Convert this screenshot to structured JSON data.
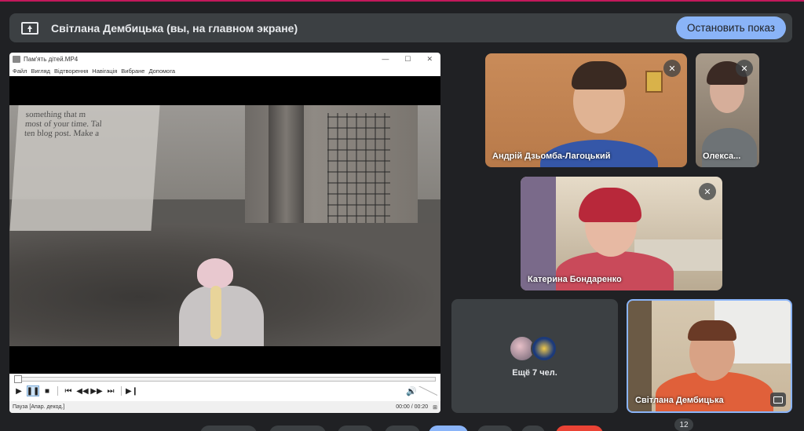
{
  "banner": {
    "presenter_text": "Світлана Дембицька (вы, на главном экране)",
    "stop_label": "Остановить показ"
  },
  "player": {
    "window_title": "Пам'ять дітей.MP4",
    "menu": [
      "Файл",
      "Вигляд",
      "Відтворення",
      "Навігація",
      "Вибране",
      "Допомога"
    ],
    "status_text": "Пауза [Апар. декод.]",
    "time_text": "00:00 / 00:20",
    "video_overlay_text": "something that m\nmost of your time. Tal\nten blog post. Make a"
  },
  "participants": [
    {
      "name": "Андрій Дзьомба-Лагоцький",
      "muted": true
    },
    {
      "name": "Олекса...",
      "muted": true
    },
    {
      "name": "Катерина Бондаренко",
      "muted": true
    },
    {
      "name": "Світлана Дембицька",
      "muted": false
    }
  ],
  "more": {
    "label": "Ещё 7 чел."
  },
  "toolbar": {
    "participants_count": "12"
  }
}
